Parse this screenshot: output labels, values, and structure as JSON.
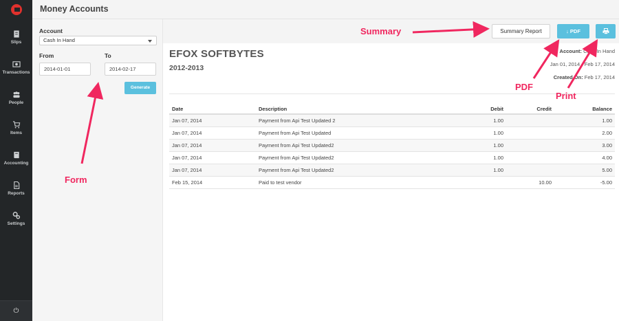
{
  "header": {
    "title": "Money Accounts"
  },
  "sidebar": {
    "items": [
      {
        "label": "Slips",
        "icon": "slips-icon"
      },
      {
        "label": "Transactions",
        "icon": "transactions-icon"
      },
      {
        "label": "People",
        "icon": "people-icon"
      },
      {
        "label": "Items",
        "icon": "cart-icon"
      },
      {
        "label": "Accounting",
        "icon": "book-icon"
      },
      {
        "label": "Reports",
        "icon": "reports-icon"
      },
      {
        "label": "Settings",
        "icon": "settings-icon"
      }
    ],
    "power_glyph": "⏻"
  },
  "form": {
    "account_label": "Account",
    "account_value": "Cash In Hand",
    "from_label": "From",
    "from_value": "2014-01-01",
    "to_label": "To",
    "to_value": "2014-02-17",
    "generate_label": "Generate"
  },
  "toolbar": {
    "summary_label": "Summary Report",
    "pdf_label": "PDF",
    "pdf_glyph": "↓",
    "print_icon": "print-icon"
  },
  "report": {
    "company": "EFOX SOFTBYTES",
    "period": "2012-2013",
    "account_line_label": "Account:",
    "account_line_value": "Cash In Hand",
    "date_range": "Jan 01, 2014 - Feb 17, 2014",
    "created_on_label": "Created On:",
    "created_on_value": "Feb 17, 2014"
  },
  "table": {
    "columns": [
      "Date",
      "Description",
      "Debit",
      "Credit",
      "Balance"
    ],
    "rows": [
      [
        "Jan 07, 2014",
        "Payment from Api Test Updated 2",
        "1.00",
        "",
        "1.00"
      ],
      [
        "Jan 07, 2014",
        "Payment from Api Test Updated",
        "1.00",
        "",
        "2.00"
      ],
      [
        "Jan 07, 2014",
        "Payment from Api Test Updated2",
        "1.00",
        "",
        "3.00"
      ],
      [
        "Jan 07, 2014",
        "Payment from Api Test Updated2",
        "1.00",
        "",
        "4.00"
      ],
      [
        "Jan 07, 2014",
        "Payment from Api Test Updated2",
        "1.00",
        "",
        "5.00"
      ],
      [
        "Feb 15, 2014",
        "Paid to test vendor",
        "",
        "10.00",
        "-5.00"
      ]
    ]
  },
  "annotations": {
    "summary": "Summary",
    "form": "Form",
    "pdf": "PDF",
    "print": "Print",
    "color": "#f0275f"
  },
  "colors": {
    "sidebar_bg": "#232628",
    "accent_blue": "#5bc0de",
    "logo_red": "#e0312d"
  }
}
